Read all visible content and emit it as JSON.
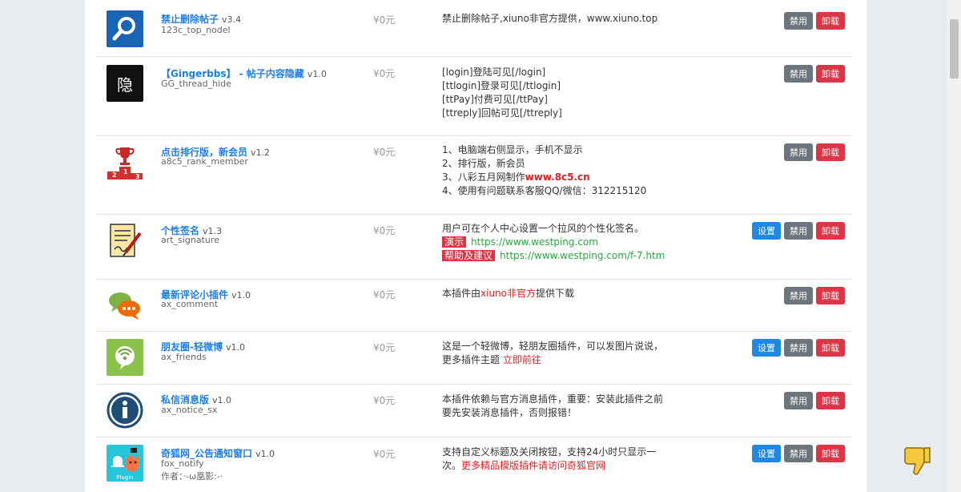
{
  "plugins": [
    {
      "name": "禁止删除帖子",
      "version": "v3.4",
      "id": "123c_top_nodel",
      "price": "¥0元",
      "desc": [
        "禁止删除帖子,xiuno非官方提供，www.xiuno.top"
      ],
      "buttons": [
        "禁用",
        "卸载"
      ],
      "icon": "magnifier-icon"
    },
    {
      "name": "【Gingerbbs】 - 帖子内容隐藏",
      "version": "v1.0",
      "id": "GG_thread_hide",
      "price": "¥0元",
      "desc": [
        "[login]登陆可见[/login]",
        "[ttlogin]登录可见[/ttlogin]",
        "[ttPay]付费可见[/ttPay]",
        "[ttreply]回帖可见[/ttreply]"
      ],
      "buttons": [
        "禁用",
        "卸载"
      ],
      "icon": "hidden-char-icon",
      "icon_char": "隐"
    },
    {
      "name": "点击排行版，新会员",
      "version": "v1.2",
      "id": "a8c5_rank_member",
      "price": "¥0元",
      "desc": [
        "1、电脑端右侧显示，手机不显示",
        "2、排行版，新会员",
        "3、八彩五月网制作",
        "4、使用有问题联系客服QQ/微信：312215120"
      ],
      "desc_highlight": "www.8c5.cn",
      "buttons": [
        "禁用",
        "卸载"
      ],
      "icon": "trophy-podium-icon",
      "podium": [
        "2",
        "1",
        "3"
      ]
    },
    {
      "name": "个性签名",
      "version": "v1.3",
      "id": "art_signature",
      "price": "¥0元",
      "desc": [
        "用户可在个人中心设置一个拉风的个性化签名。"
      ],
      "demo_label": "演示",
      "demo_url": "https://www.westping.com",
      "help_label": "帮助及建议",
      "help_url": "https://www.westping.com/f-7.htm",
      "buttons": [
        "设置",
        "禁用",
        "卸载"
      ],
      "icon": "signature-document-icon"
    },
    {
      "name": "最新评论小插件",
      "version": "v1.0",
      "id": "ax_comment",
      "price": "¥0元",
      "desc_prefix": "本插件由",
      "desc_red": "xiuno非官方",
      "desc_suffix": "提供下载",
      "buttons": [
        "禁用",
        "卸载"
      ],
      "icon": "chat-bubbles-icon"
    },
    {
      "name": "朋友圈-轻微博",
      "version": "v1.0",
      "id": "ax_friends",
      "price": "¥0元",
      "desc": [
        "这是一个轻微博，轻朋友圈插件，可以发图片说说，"
      ],
      "desc2_prefix": "更多插件主题 ",
      "desc2_link": "立即前往",
      "buttons": [
        "设置",
        "禁用",
        "卸载"
      ],
      "icon": "friends-circle-icon"
    },
    {
      "name": "私信消息版",
      "version": "v1.0",
      "id": "ax_notice_sx",
      "price": "¥0元",
      "desc": [
        "本插件依赖与官方消息插件，重要：安装此插件之前",
        "要先安装消息插件，否则报错！"
      ],
      "buttons": [
        "禁用",
        "卸载"
      ],
      "icon": "info-circle-icon"
    },
    {
      "name": "奇狐网_公告通知窗口",
      "version": "v1.0",
      "id": "fox_notify",
      "author": "作者：·-ω凰影:-·",
      "price": "¥0元",
      "desc": [
        "支持自定义标题及关闭按钮，支持24小时只显示一",
        "次。"
      ],
      "desc_red": "更多精品模版插件请访问奇狐官网",
      "buttons": [
        "设置",
        "禁用",
        "卸载"
      ],
      "icon": "fox-bell-icon",
      "icon_text": "Plugin"
    }
  ],
  "colors": {
    "link": "#1f7fe0",
    "danger": "#dc3545",
    "secondary": "#6c757d",
    "primary": "#1e88e5",
    "success": "#2aa745"
  }
}
